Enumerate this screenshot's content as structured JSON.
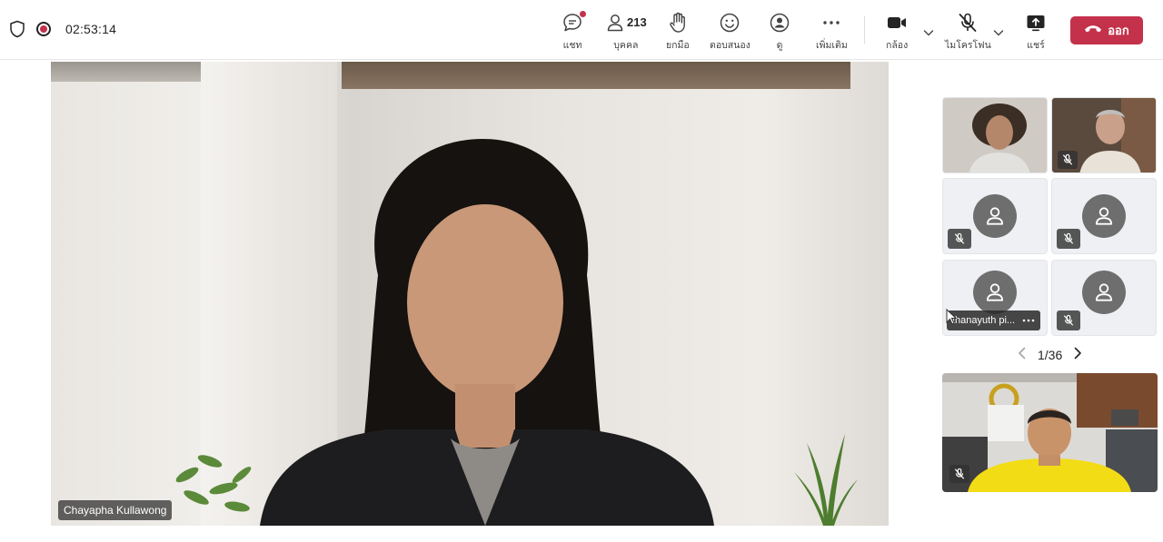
{
  "meeting": {
    "timer": "02:53:14"
  },
  "toolbar": {
    "chat_label": "แชท",
    "people_label": "บุคคล",
    "people_count": "213",
    "raise_label": "ยกมือ",
    "react_label": "ตอบสนอง",
    "view_label": "ดู",
    "more_label": "เพิ่มเติม",
    "camera_label": "กล้อง",
    "mic_label": "ไมโครโฟน",
    "share_label": "แชร์",
    "leave_label": "ออก"
  },
  "stage": {
    "speaker_name": "Chayapha Kullawong"
  },
  "gallery": {
    "highlighted_name": "thanayuth pi...",
    "page": "1/36"
  },
  "colors": {
    "leave": "#c4314b",
    "record": "#c4314b"
  },
  "icons": [
    "shield-icon",
    "record-icon",
    "chat-icon",
    "people-icon",
    "hand-icon",
    "smile-icon",
    "view-icon",
    "more-icon",
    "camera-icon",
    "chevron-down-icon",
    "mic-off-icon",
    "share-icon",
    "phone-icon",
    "person-icon",
    "chevron-left-icon",
    "chevron-right-icon"
  ]
}
